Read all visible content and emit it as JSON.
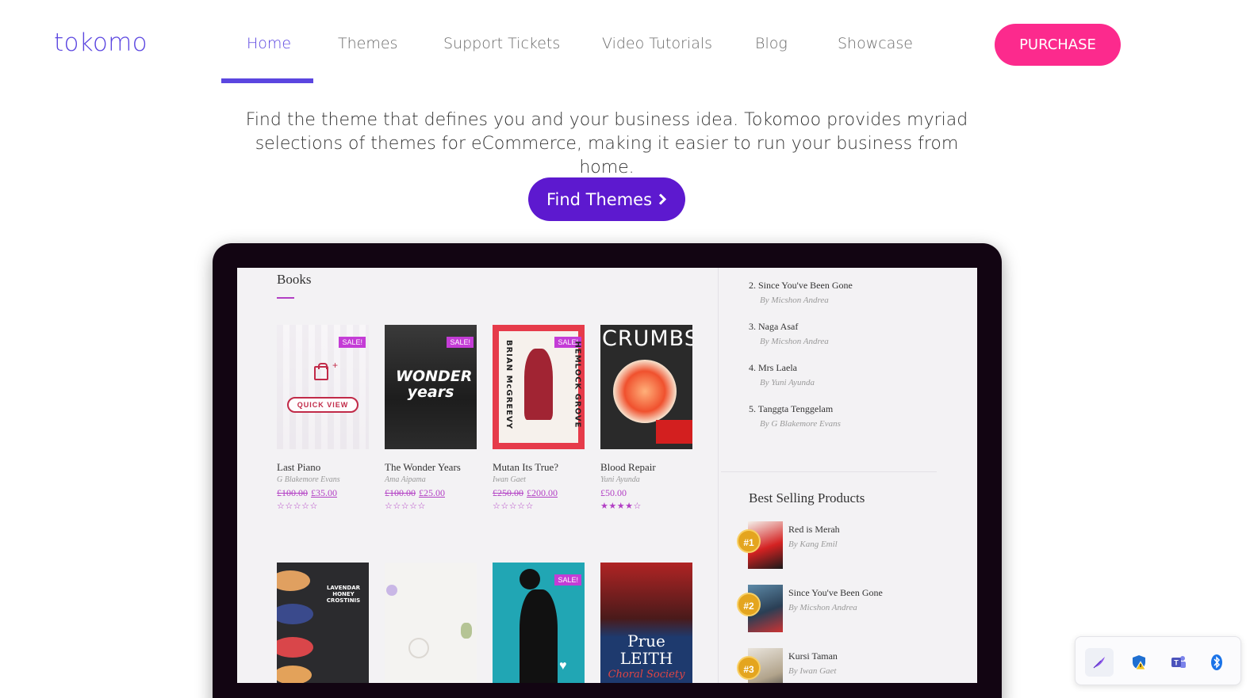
{
  "brand": {
    "logo": "tokomo"
  },
  "nav": {
    "items": [
      {
        "label": "Home",
        "active": true
      },
      {
        "label": "Themes"
      },
      {
        "label": "Support Tickets"
      },
      {
        "label": "Video Tutorials"
      },
      {
        "label": "Blog"
      },
      {
        "label": "Showcase"
      }
    ],
    "purchase_label": "PURCHASE"
  },
  "hero": {
    "line1": "Find the theme that defines you and your business idea. Tokomoo provides myriad",
    "line2": "selections of themes for eCommerce, making it easier to run your business from home.",
    "cta_label": "Find Themes",
    "cta_icon": "chevron-right-icon"
  },
  "preview": {
    "section_title": "Books",
    "books": [
      {
        "title": "Last Piano",
        "author": "G Blakemore Evans",
        "old_price": "£100.00",
        "price": "£35.00",
        "sale": "SALE!",
        "stars": "☆☆☆☆☆",
        "quick_view": "QUICK VIEW"
      },
      {
        "title": "The Wonder Years",
        "author": "Ama Aipama",
        "old_price": "£100.00",
        "price": "£25.00",
        "sale": "SALE!",
        "stars": "☆☆☆☆☆",
        "cover_text": "WONDER years"
      },
      {
        "title": "Mutan Its True?",
        "author": "Iwan Gaet",
        "old_price": "£250.00",
        "price": "£200.00",
        "sale": "SALE!",
        "stars": "☆☆☆☆☆",
        "cover_left": "BRIAN McGREEVY",
        "cover_right": "HEMLOCK GROVE"
      },
      {
        "title": "Blood Repair",
        "author": "Yuni Ayunda",
        "old_price": "",
        "price": "£50.00",
        "sale": "",
        "stars": "★★★★☆",
        "cover_text": "CRUMBS"
      }
    ],
    "row2": [
      {
        "cover_text": "LAVENDAR HONEY CROSTINIS",
        "sale": ""
      },
      {
        "cover_text": "",
        "sale": ""
      },
      {
        "cover_text": "",
        "sale": "SALE!"
      },
      {
        "cover_text": "Prue LEITH",
        "sub": "Choral Society",
        "sale": ""
      }
    ],
    "side_list": [
      {
        "title": "2. Since You've Been Gone",
        "author": "By Micshon Andrea"
      },
      {
        "title": "3. Naga Asaf",
        "author": "By Micshon Andrea"
      },
      {
        "title": "4. Mrs Laela",
        "author": "By Yuni Ayunda"
      },
      {
        "title": "5. Tanggta Tenggelam",
        "author": "By G Blakemore Evans"
      }
    ],
    "best_selling_title": "Best Selling Products",
    "best_selling": [
      {
        "rank": "#1",
        "title": "Red is Merah",
        "author": "By Kang Emil"
      },
      {
        "rank": "#2",
        "title": "Since You've Been Gone",
        "author": "By Micshon Andrea"
      },
      {
        "rank": "#3",
        "title": "Kursi Taman",
        "author": "By Iwan Gaet"
      }
    ]
  },
  "tray": {
    "icons": [
      "feather-pen-icon",
      "shield-warning-icon",
      "teams-icon",
      "bluetooth-icon"
    ]
  },
  "colors": {
    "accent": "#5b46e0",
    "purchase": "#fc2a8d",
    "cta": "#5d19cf",
    "sale": "#c43cd6"
  }
}
